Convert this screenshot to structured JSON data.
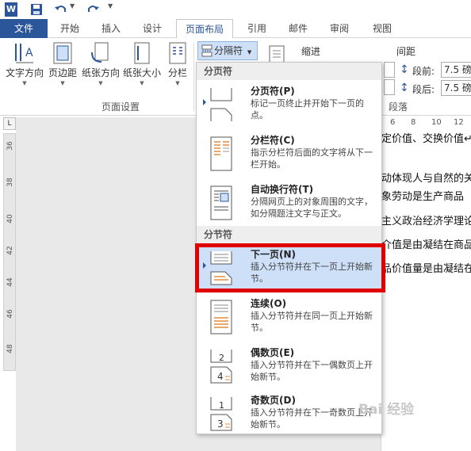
{
  "qat": {
    "logo": "W"
  },
  "tabs": [
    "文件",
    "开始",
    "插入",
    "设计",
    "页面布局",
    "引用",
    "邮件",
    "审阅",
    "视图"
  ],
  "ribbon": {
    "buttons": [
      "文字方向",
      "页边距",
      "纸张方向",
      "纸张大小",
      "分栏"
    ],
    "group_label": "页面设置",
    "split_button": "分隔符",
    "indent_label": "缩进",
    "spacing_label": "间距",
    "before_label": "段前:",
    "before_value": "7.5 磅",
    "after_label": "段后:",
    "after_value": "7.5 磅",
    "paragraph_label": "段落"
  },
  "menu": {
    "section1": "分页符",
    "section2": "分节符",
    "items": [
      {
        "title": "分页符(P)",
        "desc": "标记一页终止并开始下一页的点。"
      },
      {
        "title": "分栏符(C)",
        "desc": "指示分栏符后面的文字将从下一栏开始。"
      },
      {
        "title": "自动换行符(T)",
        "desc": "分隔网页上的对象周围的文字，如分隔题注文字与正文。"
      },
      {
        "title": "下一页(N)",
        "desc": "插入分节符并在下一页上开始新节。"
      },
      {
        "title": "连续(O)",
        "desc": "插入分节符并在同一页上开始新节。"
      },
      {
        "title": "偶数页(E)",
        "desc": "插入分节符并在下一偶数页上开始新节。"
      },
      {
        "title": "奇数页(D)",
        "desc": "插入分节符并在下一奇数页上开始新节。"
      }
    ]
  },
  "ruler": {
    "left_numbers": [
      "36",
      "38",
      "40",
      "42",
      "44",
      "46",
      "48"
    ],
    "top_numbers": [
      "6",
      "8",
      "10",
      "12"
    ],
    "corner": "L"
  },
  "document": {
    "lines": [
      "定价值、交换价值↵",
      "动体现人与自然的关",
      "象劳动是生产商品",
      "主义政治经济学理论",
      "介值是由凝结在商品",
      "品价值量是由凝结在"
    ]
  },
  "watermark": "Bai 经验"
}
